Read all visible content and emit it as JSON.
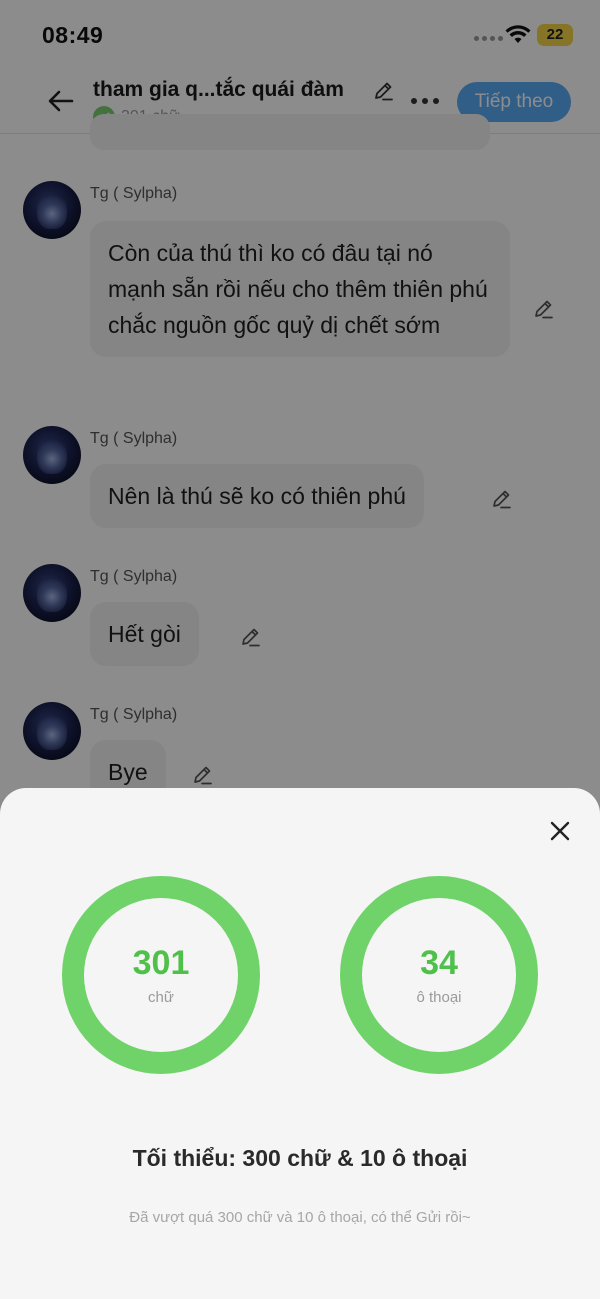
{
  "status_bar": {
    "time": "08:49",
    "battery": "22"
  },
  "navbar": {
    "title": "tham gia q...tắc quái đàm",
    "subtitle": "301 chữ",
    "next_label": "Tiếp theo"
  },
  "messages": [
    {
      "sender": "Tg ( Sylpha)",
      "text": "Còn của thú thì ko có đâu tại nó mạnh sẵn rồi nếu cho thêm thiên phú chắc nguồn gốc quỷ dị chết sớm"
    },
    {
      "sender": "Tg ( Sylpha)",
      "text": "Nên là thú sẽ ko có thiên phú"
    },
    {
      "sender": "Tg ( Sylpha)",
      "text": "Hết gòi"
    },
    {
      "sender": "Tg ( Sylpha)",
      "text": "Bye"
    }
  ],
  "sheet": {
    "words_count": "301",
    "words_label": "chữ",
    "dialogs_count": "34",
    "dialogs_label": "ô thoại",
    "minimum_text": "Tối thiểu: 300 chữ & 10 ô thoại",
    "note_text": "Đã vượt quá 300 chữ và 10 ô thoại, có thể Gửi rồi~"
  },
  "colors": {
    "accent_blue": "#5aabf5",
    "ring_green": "#6fd36a",
    "count_green": "#4fc14a",
    "battery_yellow": "#f5d547"
  },
  "icons": [
    "back-arrow-icon",
    "pencil-icon",
    "check-icon",
    "more-icon",
    "close-icon",
    "wifi-icon",
    "signal-icon"
  ]
}
